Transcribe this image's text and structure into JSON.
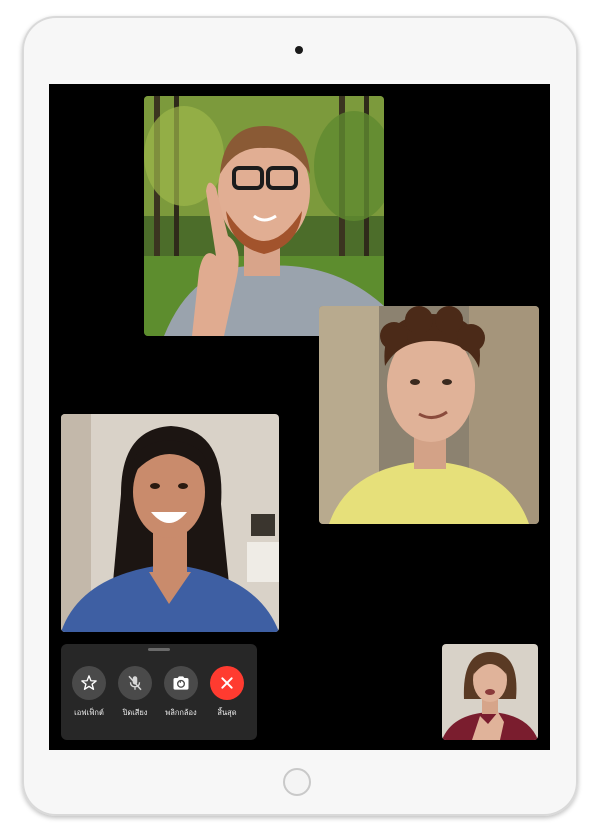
{
  "facetime": {
    "participants": [
      {
        "id": "participant-1",
        "shirt_color": "#9aa3ad"
      },
      {
        "id": "participant-2",
        "shirt_color": "#e6e07a"
      },
      {
        "id": "participant-3",
        "shirt_color": "#3e5fa3"
      }
    ],
    "self_view": {
      "shirt_color": "#7a1d2e"
    },
    "controls": [
      {
        "label": "เอฟเฟ็กต์",
        "icon": "effects-star-icon"
      },
      {
        "label": "ปิดเสียง",
        "icon": "mic-mute-icon"
      },
      {
        "label": "พลิกกล้อง",
        "icon": "flip-camera-icon"
      },
      {
        "label": "สิ้นสุด",
        "icon": "end-call-x-icon",
        "color": "#ff3b30"
      }
    ]
  }
}
